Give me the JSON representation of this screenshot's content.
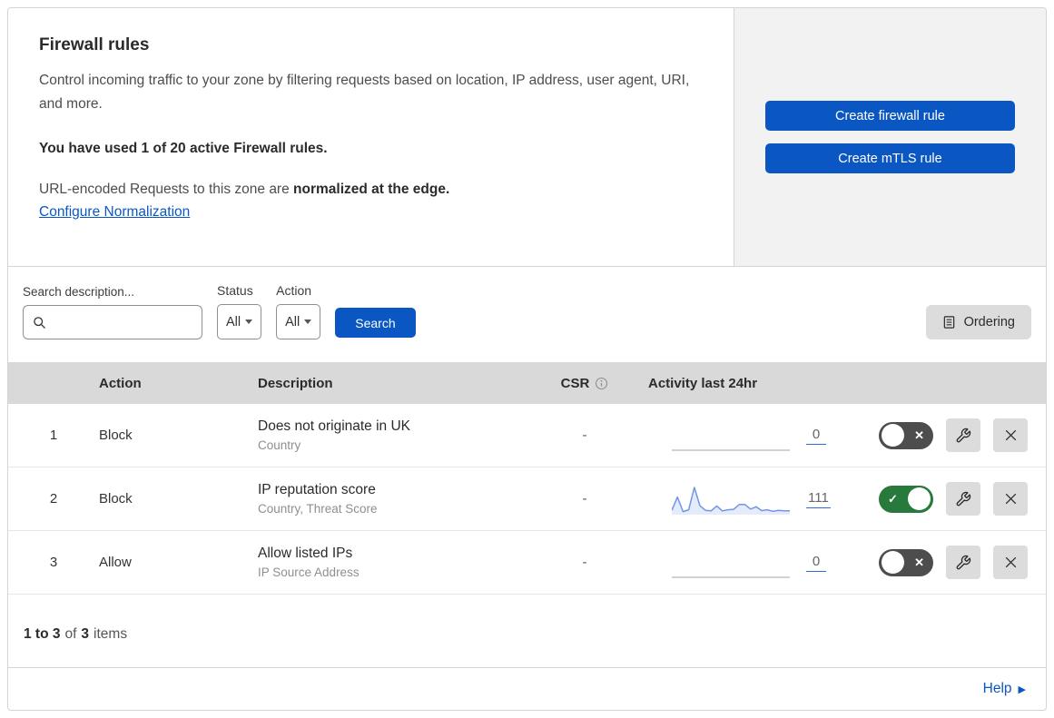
{
  "header": {
    "title": "Firewall rules",
    "description": "Control incoming traffic to your zone by filtering requests based on location, IP address, user agent, URI, and more.",
    "usage_text": "You have used 1 of 20 active Firewall rules.",
    "normalization_prefix": "URL-encoded Requests to this zone are ",
    "normalization_bold": "normalized at the edge.",
    "normalization_link": "Configure Normalization",
    "buttons": [
      {
        "label": "Create firewall rule"
      },
      {
        "label": "Create mTLS rule"
      }
    ]
  },
  "filters": {
    "search_label": "Search description...",
    "search_value": "",
    "status_label": "Status",
    "status_value": "All",
    "action_label": "Action",
    "action_value": "All",
    "search_button_label": "Search",
    "ordering_button_label": "Ordering"
  },
  "table": {
    "headers": {
      "action": "Action",
      "description": "Description",
      "csr": "CSR",
      "activity": "Activity last 24hr"
    },
    "rows": [
      {
        "index": "1",
        "action": "Block",
        "description": "Does not originate in UK",
        "fields": "Country",
        "csr": "-",
        "activity_count": "0",
        "enabled": false,
        "sparkline": []
      },
      {
        "index": "2",
        "action": "Block",
        "description": "IP reputation score",
        "fields": "Country, Threat Score",
        "csr": "-",
        "activity_count": "111",
        "enabled": true,
        "sparkline": [
          10,
          62,
          5,
          12,
          100,
          28,
          10,
          8,
          27,
          8,
          12,
          14,
          33,
          33,
          15,
          24,
          9,
          12,
          6,
          10,
          8,
          8
        ]
      },
      {
        "index": "3",
        "action": "Allow",
        "description": "Allow listed IPs",
        "fields": "IP Source Address",
        "csr": "-",
        "activity_count": "0",
        "enabled": false,
        "sparkline": []
      }
    ]
  },
  "footer": {
    "range": "1 to 3",
    "of_label": "of",
    "total": "3",
    "items_label": "items",
    "help_label": "Help"
  },
  "colors": {
    "primary_blue": "#0a57c4",
    "link_blue": "#0a57c4",
    "toggle_on_green": "#27793c",
    "toggle_off_gray": "#4d4d4d",
    "sparkline_blue": "#7296e3",
    "sparkline_fill": "#e4ebfa",
    "table_header_bg": "#d9d9d9",
    "panel_bg": "#f2f2f2"
  }
}
